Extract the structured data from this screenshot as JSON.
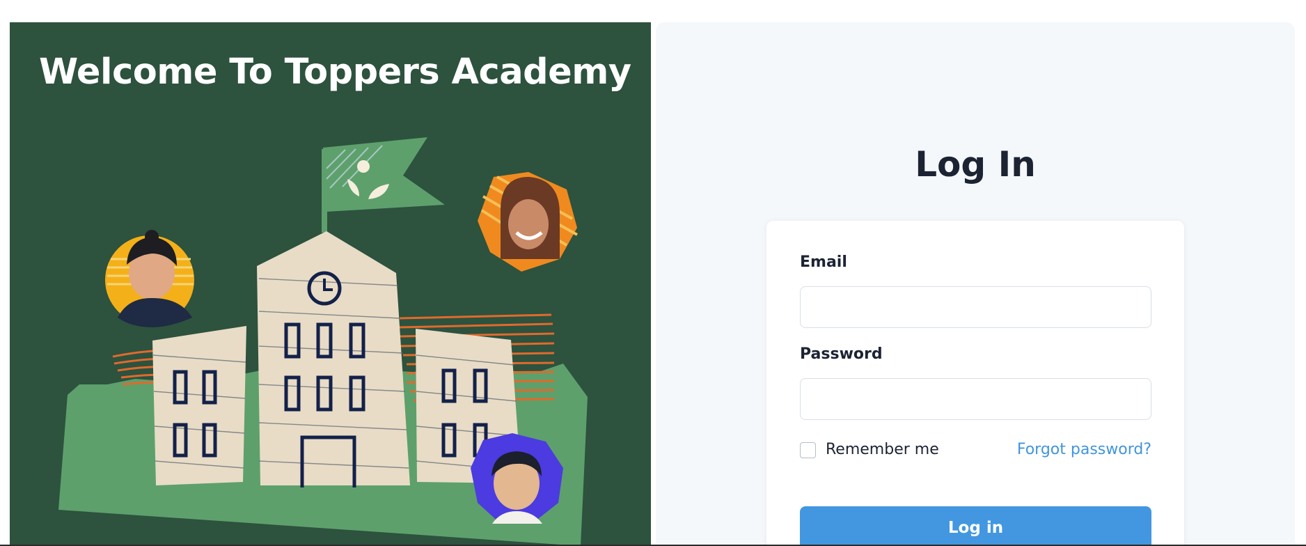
{
  "left_panel": {
    "title": "Welcome To Toppers Academy",
    "colors": {
      "background": "#2d523e",
      "ground": "#5da06c",
      "building": "#e8dcc6",
      "window": "#13214a",
      "stripe": "#e16a2c"
    }
  },
  "login": {
    "heading": "Log In",
    "email_label": "Email",
    "email_value": "",
    "password_label": "Password",
    "password_value": "",
    "remember_label": "Remember me",
    "remember_checked": false,
    "forgot_label": "Forgot password?",
    "submit_label": "Log in"
  },
  "colors": {
    "accent": "#4297e0",
    "link": "#4095dd",
    "panel_bg": "#f5f8fb",
    "text": "#1c2333"
  }
}
